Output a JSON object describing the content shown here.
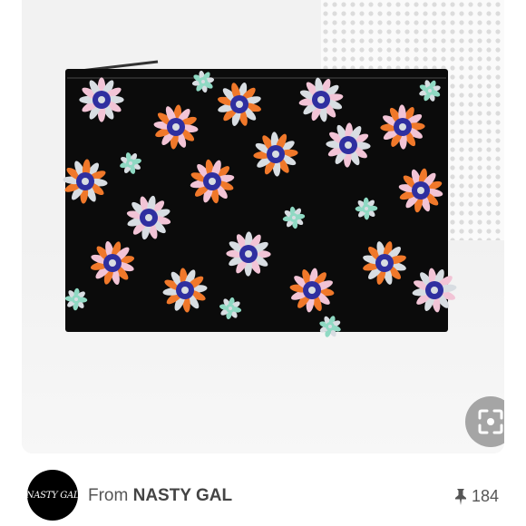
{
  "source": {
    "prefix": "From",
    "brand": "NASTY GAL",
    "avatar_label": "NASTY GAL"
  },
  "saves": {
    "icon": "pin-icon",
    "count": "184"
  },
  "icons": {
    "visual_search": "visual-search-icon"
  },
  "colors": {
    "clutch_body": "#0b0b0b",
    "jewel_orange": "#f0782a",
    "jewel_pink": "#f2c4d6",
    "jewel_blue": "#2f2fa0",
    "jewel_mint": "#8fd9c3",
    "jewel_clear": "#d8dde2"
  }
}
